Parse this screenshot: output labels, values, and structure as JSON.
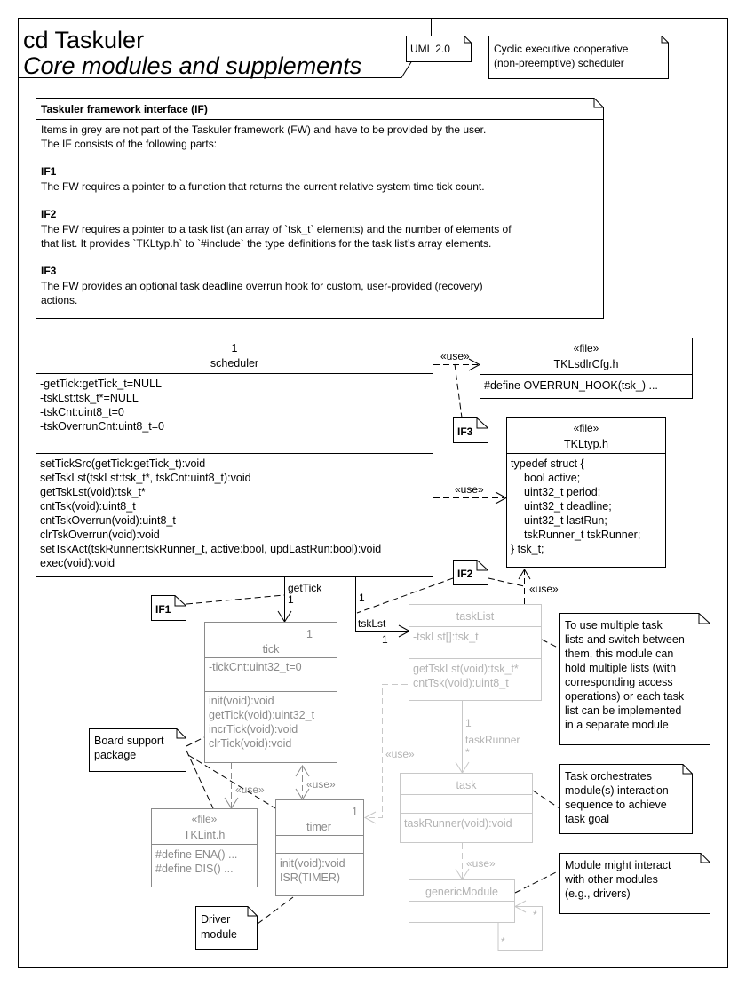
{
  "frame": {
    "kind": "cd Taskuler",
    "subtitle": "Core modules and supplements",
    "uml_note": "UML 2.0",
    "desc_note": [
      "Cyclic executive cooperative",
      "(non-preemptive) scheduler"
    ]
  },
  "if_note": {
    "title": "Taskuler framework interface (IF)",
    "intro": [
      "Items in grey are not part of the Taskuler framework (FW) and have to be provided by the user.",
      "The IF consists of the following parts:"
    ],
    "parts": [
      {
        "heading": "IF1",
        "lines": [
          "The FW requires a pointer to a function that returns the current relative system time tick count."
        ]
      },
      {
        "heading": "IF2",
        "lines": [
          "The FW requires a pointer to a task list (an array of `tsk_t` elements) and the number of elements of",
          "that list.  It provides `TKLtyp.h` to `#include` the type definitions for the task list’s array elements."
        ]
      },
      {
        "heading": "IF3",
        "lines": [
          "The FW provides an optional task deadline overrun hook for custom, user-provided (recovery)",
          "actions."
        ]
      }
    ]
  },
  "scheduler": {
    "multiplicity": "1",
    "name": "scheduler",
    "attributes": [
      "-getTick:getTick_t=NULL",
      "-tskLst:tsk_t*=NULL",
      "-tskCnt:uint8_t=0",
      "-tskOverrunCnt:uint8_t=0"
    ],
    "operations": [
      "setTickSrc(getTick:getTick_t):void",
      "setTskLst(tskLst:tsk_t*, tskCnt:uint8_t):void",
      "getTskLst(void):tsk_t*",
      "cntTsk(void):uint8_t",
      "cntTskOverrun(void):uint8_t",
      "clrTskOverrun(void):void",
      "setTskAct(tskRunner:tskRunner_t, active:bool, updLastRun:bool):void",
      "exec(void):void"
    ]
  },
  "cfg_file": {
    "stereotype": "«file»",
    "name": "TKLsdlrCfg.h",
    "body": [
      "#define OVERRUN_HOOK(tsk_) ..."
    ]
  },
  "typ_file": {
    "stereotype": "«file»",
    "name": "TKLtyp.h",
    "body": [
      "typedef struct {",
      "   bool active;",
      "   uint32_t period;",
      "   uint32_t deadline;",
      "   uint32_t lastRun;",
      "   tskRunner_t tskRunner;",
      "} tsk_t;"
    ]
  },
  "tick": {
    "multiplicity": "1",
    "name": "tick",
    "attributes": [
      "-tickCnt:uint32_t=0"
    ],
    "operations": [
      "init(void):void",
      "getTick(void):uint32_t",
      "incrTick(void):void",
      "clrTick(void):void"
    ]
  },
  "tasklist": {
    "name": "taskList",
    "attributes": [
      "-tskLst[]:tsk_t"
    ],
    "operations": [
      "getTskLst(void):tsk_t*",
      "cntTsk(void):uint8_t"
    ]
  },
  "task": {
    "name": "task",
    "operations": [
      "taskRunner(void):void"
    ]
  },
  "generic": {
    "name": "genericModule"
  },
  "timer": {
    "multiplicity": "1",
    "name": "timer",
    "operations": [
      "init(void):void",
      "ISR(TIMER)"
    ]
  },
  "int_file": {
    "stereotype": "«file»",
    "name": "TKLint.h",
    "body": [
      "#define ENA() ...",
      "#define DIS() ..."
    ]
  },
  "tags": {
    "if1": "IF1",
    "if2": "IF2",
    "if3": "IF3"
  },
  "notes": {
    "tasklist": [
      "To use multiple task",
      "lists and switch between",
      "them, this module can",
      "hold multiple lists (with",
      "corresponding access",
      "operations) or each task",
      "list can be implemented",
      "in a separate module"
    ],
    "task": [
      "Task orchestrates",
      "module(s) interaction",
      "sequence to achieve",
      "task goal"
    ],
    "generic": [
      "Module might interact",
      "with other modules",
      "(e.g., drivers)"
    ],
    "bsp": [
      "Board support",
      "package"
    ],
    "driver": [
      "Driver",
      "module"
    ]
  },
  "labels": {
    "use": "«use»",
    "getTick": "getTick",
    "tskLst": "tskLst",
    "taskRunner": "taskRunner",
    "one": "1",
    "many": "*"
  }
}
